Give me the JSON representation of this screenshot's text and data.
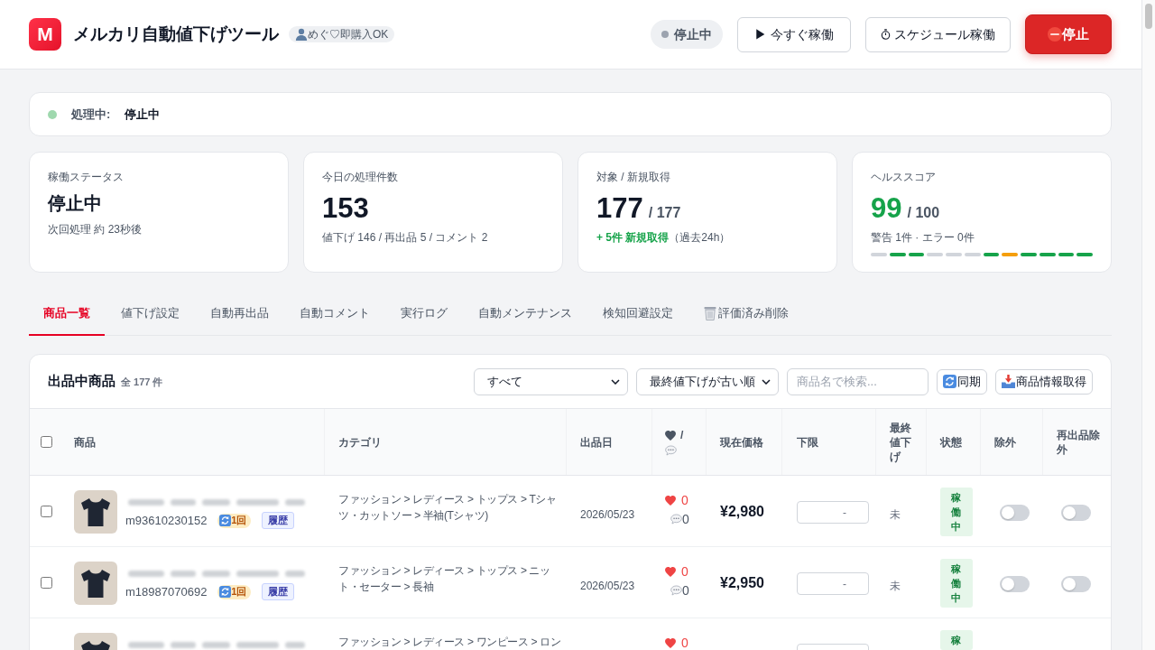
{
  "header": {
    "logo": "M",
    "title": "メルカリ自動値下げツール",
    "account": "めぐ♡即購入OK",
    "status": "停止中",
    "buttons": [
      {
        "kind": "run",
        "label": "▶ 今すぐ稼働"
      },
      {
        "kind": "schedule",
        "label": "スケジュール稼働"
      },
      {
        "kind": "stop",
        "label": "停止"
      }
    ]
  },
  "process": {
    "label": "処理中:",
    "value": "停止中"
  },
  "stats": [
    {
      "kind": "status",
      "label": "稼働ステータス",
      "value": "停止中",
      "detail": "次回処理 約 23秒後"
    },
    {
      "kind": "count",
      "label": "今日の処理件数",
      "value": "153",
      "detail": "値下げ 146 / 再出品 5 / コメント 2"
    },
    {
      "kind": "ratio",
      "label": "対象 / 新規取得",
      "value": "177",
      "total": "/ 177",
      "highlight": "+ 5件 新規取得",
      "note": "（過去24h）"
    },
    {
      "kind": "health",
      "label": "ヘルススコア",
      "value": "99",
      "total": "/ 100",
      "detail": "警告 1件 · エラー 0件",
      "segments": [
        {
          "color": "#d1d5db"
        },
        {
          "color": "#16a34a"
        },
        {
          "color": "#16a34a"
        },
        {
          "color": "#d1d5db"
        },
        {
          "color": "#d1d5db"
        },
        {
          "color": "#d1d5db"
        },
        {
          "color": "#16a34a"
        },
        {
          "color": "#f59e0b"
        },
        {
          "color": "#16a34a"
        },
        {
          "color": "#16a34a"
        },
        {
          "color": "#16a34a"
        },
        {
          "color": "#16a34a"
        }
      ]
    }
  ],
  "tabs": [
    {
      "kind": "page",
      "label": "商品一覧",
      "selected": true
    },
    {
      "kind": "page",
      "label": "値下げ設定",
      "selected": false
    },
    {
      "kind": "page",
      "label": "自動再出品",
      "selected": false
    },
    {
      "kind": "page",
      "label": "自動コメント",
      "selected": false
    },
    {
      "kind": "page",
      "label": "実行ログ",
      "selected": false
    },
    {
      "kind": "page",
      "label": "自動メンテナンス",
      "selected": false
    },
    {
      "kind": "page",
      "label": "検知回避設定",
      "selected": false
    },
    {
      "kind": "delete",
      "label": "評価済み削除",
      "selected": false
    }
  ],
  "products": {
    "title": "出品中商品",
    "count": "全 177 件",
    "filter": "すべて",
    "sort": "最終値下げが古い順",
    "search_placeholder": "商品名で検索...",
    "actions": [
      {
        "kind": "sync",
        "label": "同期"
      },
      {
        "kind": "fetch",
        "label": "商品情報取得"
      }
    ],
    "select_all": {
      "checked": false
    },
    "columns": [
      {
        "kind": "text",
        "label": "商品"
      },
      {
        "kind": "text",
        "label": "カテゴリ"
      },
      {
        "kind": "text",
        "label": "出品日"
      },
      {
        "kind": "reactions",
        "label": "/"
      },
      {
        "kind": "text",
        "label": "現在価格"
      },
      {
        "kind": "text",
        "label": "下限"
      },
      {
        "kind": "text",
        "label": "最終値下げ"
      },
      {
        "kind": "text",
        "label": "状態"
      },
      {
        "kind": "text",
        "label": "除外"
      },
      {
        "kind": "text",
        "label": "再出品除外"
      }
    ],
    "rows": [
      {
        "checked": false,
        "item_id": "m93610230152",
        "relist": "1回",
        "history": "履歴",
        "category": "ファッション > レディース > トップス > Tシャツ・カットソー > 半袖(Tシャツ)",
        "listed": "2026/05/23",
        "likes": "0",
        "comments": "0",
        "price": "¥2,980",
        "floor_placeholder": "-",
        "last_markdown": "未",
        "status": "稼働中",
        "excluded": false,
        "relist_excluded": false
      },
      {
        "checked": false,
        "item_id": "m18987070692",
        "relist": "1回",
        "history": "履歴",
        "category": "ファッション > レディース > トップス > ニット・セーター > 長袖",
        "listed": "2026/05/23",
        "likes": "0",
        "comments": "0",
        "price": "¥2,950",
        "floor_placeholder": "-",
        "last_markdown": "未",
        "status": "稼働中",
        "excluded": false,
        "relist_excluded": false
      },
      {
        "category": "ファッション > レディース > ワンピース > ロン",
        "likes": "0",
        "status": "稼"
      }
    ]
  }
}
